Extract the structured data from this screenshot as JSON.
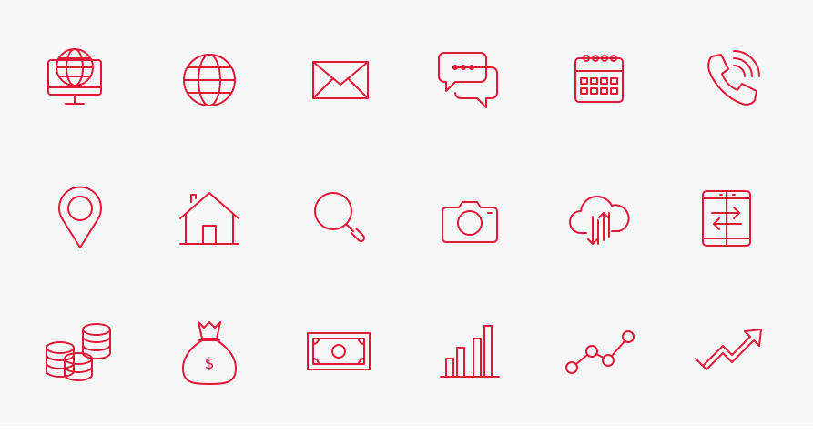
{
  "theme": {
    "background": "#f8f8f9",
    "icon_color": "#e31837"
  },
  "icon_grid": {
    "rows": [
      [
        "monitor-globe-icon",
        "globe-icon",
        "envelope-icon",
        "chat-bubbles-icon",
        "calendar-icon",
        "phone-call-icon"
      ],
      [
        "map-pin-icon",
        "home-icon",
        "search-icon",
        "camera-icon",
        "cloud-transfer-icon",
        "phone-swap-icon"
      ],
      [
        "coins-icon",
        "money-bag-icon",
        "banknote-icon",
        "bar-chart-icon",
        "line-graph-icon",
        "trend-up-arrow-icon"
      ]
    ]
  },
  "money_bag": {
    "symbol": "$"
  }
}
